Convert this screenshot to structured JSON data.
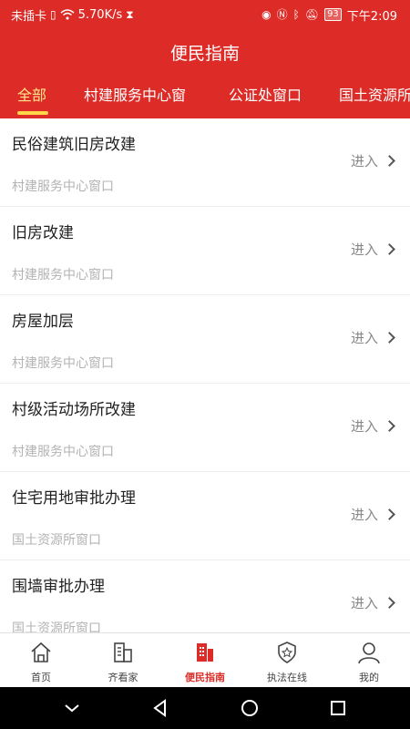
{
  "status_bar": {
    "carrier": "未插卡",
    "speed": "5.70K/s",
    "battery": "93",
    "time": "下午2:09"
  },
  "header": {
    "title": "便民指南"
  },
  "tabs": [
    {
      "label": "全部",
      "active": true
    },
    {
      "label": "村建服务中心窗"
    },
    {
      "label": "公证处窗口"
    },
    {
      "label": "国土资源所"
    }
  ],
  "list": {
    "enter_label": "进入",
    "items": [
      {
        "title": "民俗建筑旧房改建",
        "subtitle": "村建服务中心窗口"
      },
      {
        "title": "旧房改建",
        "subtitle": "村建服务中心窗口"
      },
      {
        "title": "房屋加层",
        "subtitle": "村建服务中心窗口"
      },
      {
        "title": "村级活动场所改建",
        "subtitle": "村建服务中心窗口"
      },
      {
        "title": "住宅用地审批办理",
        "subtitle": "国土资源所窗口"
      },
      {
        "title": "围墙审批办理",
        "subtitle": "国土资源所窗口"
      }
    ]
  },
  "tabbar": {
    "items": [
      {
        "label": "首页",
        "icon": "home-icon"
      },
      {
        "label": "齐看家",
        "icon": "building-icon"
      },
      {
        "label": "便民指南",
        "icon": "guide-icon",
        "active": true
      },
      {
        "label": "执法在线",
        "icon": "badge-icon"
      },
      {
        "label": "我的",
        "icon": "user-icon"
      }
    ]
  },
  "colors": {
    "primary": "#dd2c27",
    "active_tab_text": "#ffe58a",
    "tab_underline": "#ffd54a"
  }
}
